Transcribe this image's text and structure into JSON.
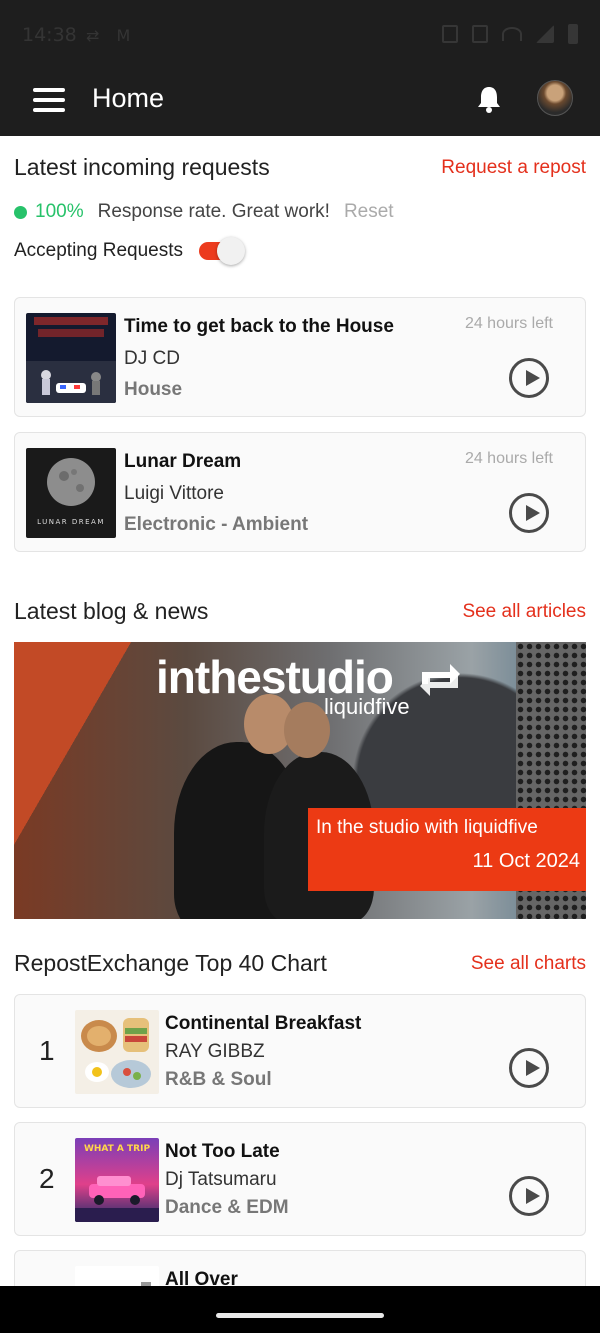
{
  "status_bar": {
    "time": "14:38",
    "left_icons": "⇄ M"
  },
  "app_bar": {
    "title": "Home"
  },
  "requests": {
    "title": "Latest incoming requests",
    "link": "Request a repost",
    "rate_percent": "100%",
    "rate_message": "Response rate. Great work!",
    "reset_label": "Reset",
    "accepting_label": "Accepting Requests",
    "accepting_on": true,
    "items": [
      {
        "title": "Time to get back to the House",
        "artist": "DJ CD",
        "genre": "House",
        "time_left": "24 hours left"
      },
      {
        "title": "Lunar Dream",
        "artist": "Luigi Vittore",
        "genre": "Electronic - Ambient",
        "time_left": "24 hours left",
        "art_text": "LUNAR DREAM"
      }
    ]
  },
  "blog": {
    "title": "Latest blog & news",
    "link": "See all articles",
    "featured": {
      "logo_main": "inthestudio",
      "logo_sub": "liquidfive",
      "caption_title": "In the studio with liquidfive",
      "caption_date": "11 Oct 2024"
    }
  },
  "chart": {
    "title": "RepostExchange Top 40 Chart",
    "link": "See all charts",
    "items": [
      {
        "rank": "1",
        "title": "Continental Breakfast",
        "artist": "RAY GIBBZ",
        "genre": "R&B & Soul"
      },
      {
        "rank": "2",
        "title": "Not Too Late",
        "artist": "Dj Tatsumaru",
        "genre": "Dance & EDM",
        "art_text": "WHAT A TRIP"
      },
      {
        "rank": "",
        "title": "All Over",
        "artist": "",
        "genre": ""
      }
    ]
  },
  "colors": {
    "accent": "#e4301c",
    "positive": "#27c26a",
    "app_bar": "#1e1e1e"
  },
  "icons": {
    "menu": "hamburger-icon",
    "notifications": "bell-icon",
    "play": "play-icon"
  }
}
